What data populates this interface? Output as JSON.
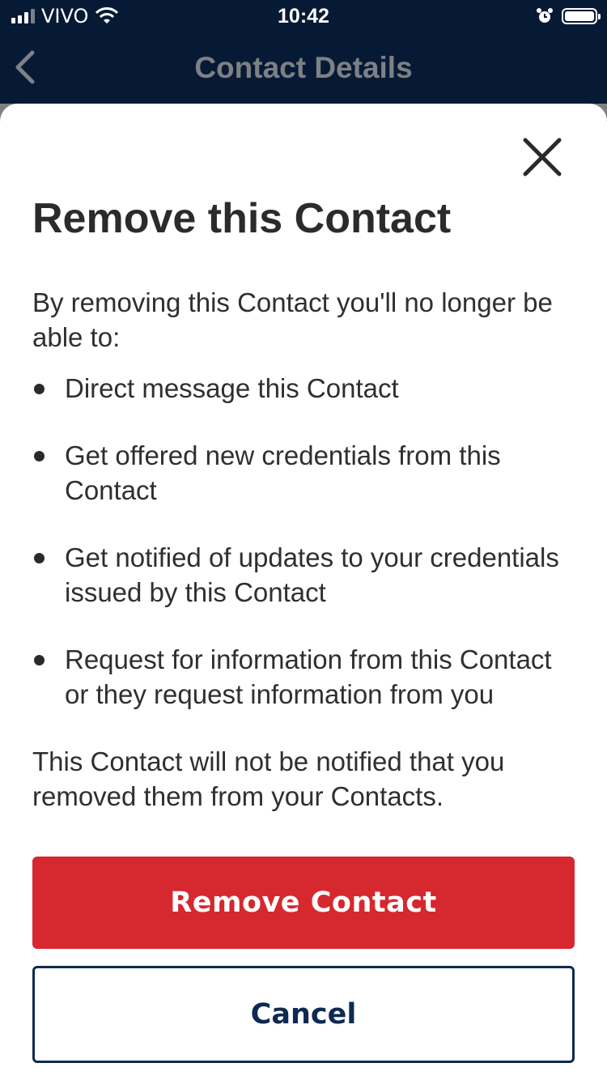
{
  "status_bar": {
    "carrier": "VIVO",
    "time": "10:42",
    "icons": [
      "signal-icon",
      "wifi-icon",
      "alarm-icon",
      "battery-icon"
    ]
  },
  "nav": {
    "title": "Contact Details",
    "back_icon": "chevron-left-icon"
  },
  "modal": {
    "close_icon": "close-icon",
    "title": "Remove this Contact",
    "intro": "By removing this Contact you'll no longer be able to:",
    "bullets": [
      "Direct message this Contact",
      "Get offered new credentials from this Contact",
      "Get notified of updates to your credentials issued by this Contact",
      "Request for information from this Contact or they request information from you"
    ],
    "footer": "This Contact will not be notified that you removed them from your Contacts.",
    "primary_button": "Remove Contact",
    "secondary_button": "Cancel"
  },
  "colors": {
    "header_bg": "#071a35",
    "danger": "#d6282f",
    "cancel_border": "#0e2a52"
  }
}
